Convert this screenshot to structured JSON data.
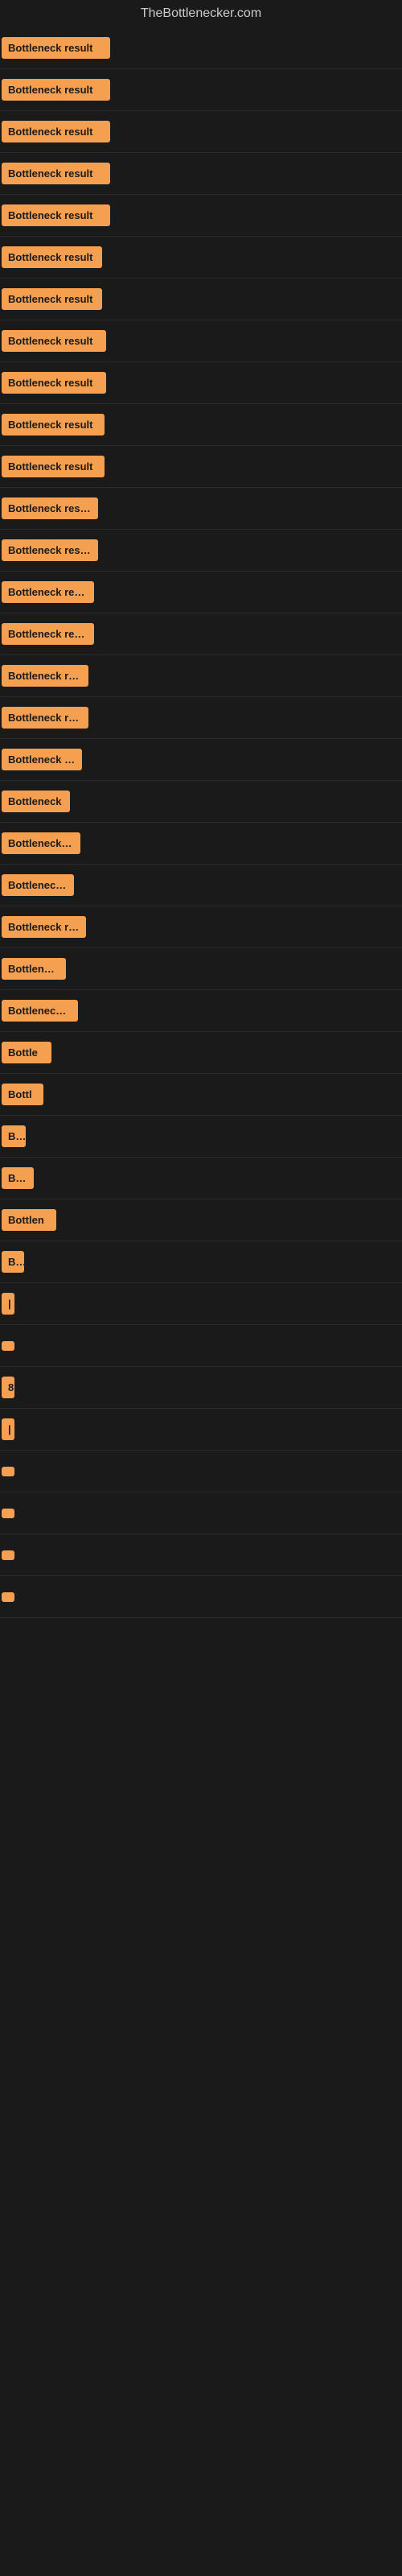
{
  "site": {
    "title": "TheBottlenecker.com"
  },
  "rows": [
    {
      "id": 1,
      "label": "Bottleneck result",
      "width": 135
    },
    {
      "id": 2,
      "label": "Bottleneck result",
      "width": 135
    },
    {
      "id": 3,
      "label": "Bottleneck result",
      "width": 135
    },
    {
      "id": 4,
      "label": "Bottleneck result",
      "width": 135
    },
    {
      "id": 5,
      "label": "Bottleneck result",
      "width": 135
    },
    {
      "id": 6,
      "label": "Bottleneck result",
      "width": 125
    },
    {
      "id": 7,
      "label": "Bottleneck result",
      "width": 125
    },
    {
      "id": 8,
      "label": "Bottleneck result",
      "width": 130
    },
    {
      "id": 9,
      "label": "Bottleneck result",
      "width": 130
    },
    {
      "id": 10,
      "label": "Bottleneck result",
      "width": 128
    },
    {
      "id": 11,
      "label": "Bottleneck result",
      "width": 128
    },
    {
      "id": 12,
      "label": "Bottleneck result",
      "width": 120
    },
    {
      "id": 13,
      "label": "Bottleneck result",
      "width": 120
    },
    {
      "id": 14,
      "label": "Bottleneck result",
      "width": 115
    },
    {
      "id": 15,
      "label": "Bottleneck result",
      "width": 115
    },
    {
      "id": 16,
      "label": "Bottleneck resu",
      "width": 108
    },
    {
      "id": 17,
      "label": "Bottleneck result",
      "width": 108
    },
    {
      "id": 18,
      "label": "Bottleneck res",
      "width": 100
    },
    {
      "id": 19,
      "label": "Bottleneck",
      "width": 85
    },
    {
      "id": 20,
      "label": "Bottleneck res",
      "width": 98
    },
    {
      "id": 21,
      "label": "Bottleneck re",
      "width": 90
    },
    {
      "id": 22,
      "label": "Bottleneck resul",
      "width": 105
    },
    {
      "id": 23,
      "label": "Bottleneck",
      "width": 80
    },
    {
      "id": 24,
      "label": "Bottleneck res",
      "width": 95
    },
    {
      "id": 25,
      "label": "Bottle",
      "width": 62
    },
    {
      "id": 26,
      "label": "Bottl",
      "width": 52
    },
    {
      "id": 27,
      "label": "Bo",
      "width": 30
    },
    {
      "id": 28,
      "label": "Bott",
      "width": 40
    },
    {
      "id": 29,
      "label": "Bottlen",
      "width": 68
    },
    {
      "id": 30,
      "label": "Bo",
      "width": 28
    },
    {
      "id": 31,
      "label": "|",
      "width": 10
    },
    {
      "id": 32,
      "label": "",
      "width": 8
    },
    {
      "id": 33,
      "label": "8",
      "width": 14
    },
    {
      "id": 34,
      "label": "|",
      "width": 8
    },
    {
      "id": 35,
      "label": "",
      "width": 6
    },
    {
      "id": 36,
      "label": "",
      "width": 5
    },
    {
      "id": 37,
      "label": "",
      "width": 5
    },
    {
      "id": 38,
      "label": "",
      "width": 4
    }
  ]
}
